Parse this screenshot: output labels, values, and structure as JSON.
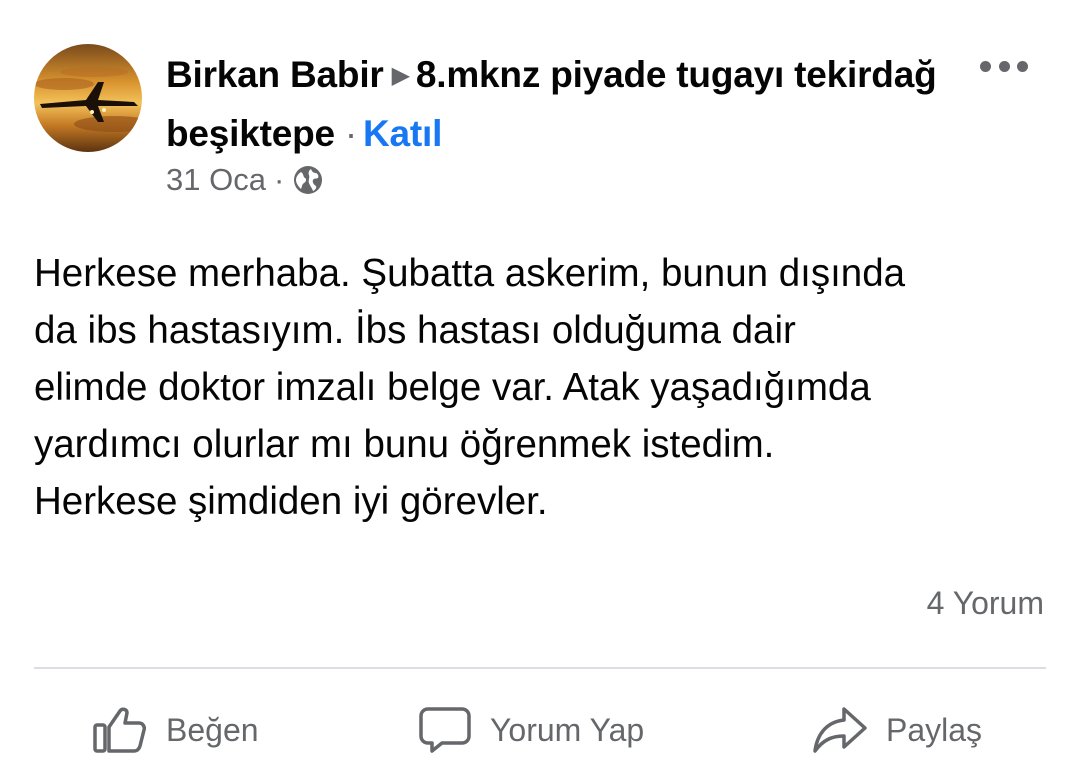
{
  "post": {
    "author": "Birkan Babir",
    "group": "8.mknz piyade tugayı tekirdağ beşiktepe",
    "join_label": "Katıl",
    "date": "31 Oca",
    "date_separator": "·",
    "audience_icon": "globe-icon",
    "more_icon": "more-options-icon",
    "body": "Herkese merhaba. Şubatta askerim, bunun dışında\nda ibs hastasıyım. İbs hastası olduğuma dair\nelimde doktor imzalı belge var.  Atak yaşadığımda\nyardımcı olurlar mı bunu öğrenmek istedim.\nHerkese şimdiden iyi görevler.",
    "comment_count": "4 Yorum"
  },
  "actions": {
    "like_label": "Beğen",
    "comment_label": "Yorum Yap",
    "share_label": "Paylaş"
  },
  "colors": {
    "link_blue": "#1877f2",
    "secondary_text": "#65676b",
    "primary_text": "#050505",
    "divider": "#dadde1"
  }
}
